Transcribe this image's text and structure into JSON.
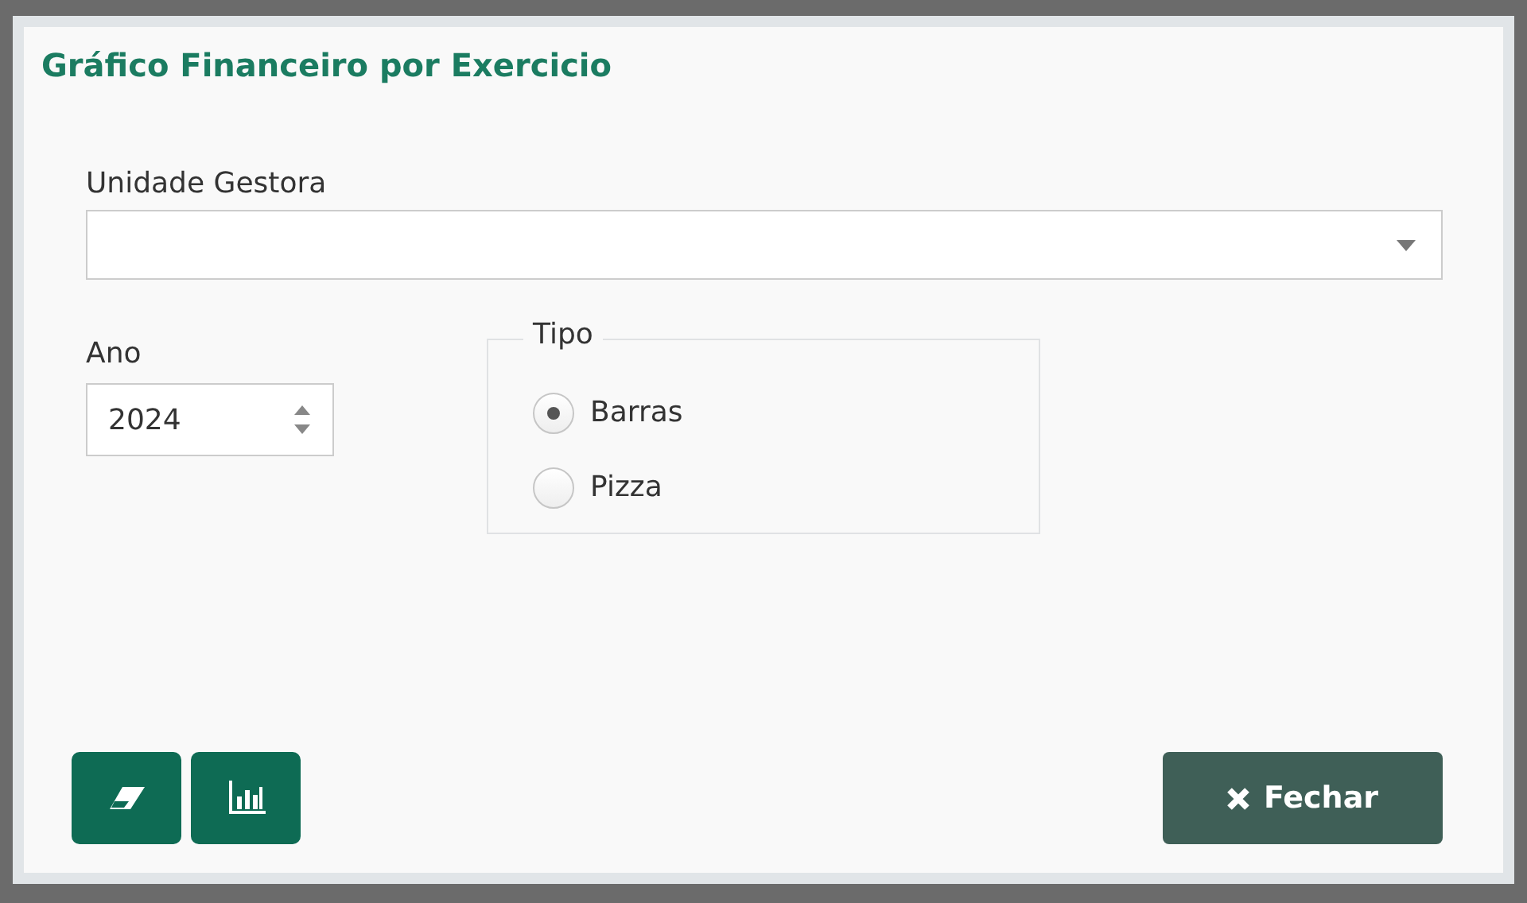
{
  "dialog": {
    "title": "Gráfico Financeiro por Exercicio"
  },
  "unidade_gestora": {
    "label": "Unidade Gestora"
  },
  "ano": {
    "label": "Ano",
    "value": "2024"
  },
  "tipo": {
    "legend": "Tipo",
    "options": [
      {
        "label": "Barras",
        "selected": true
      },
      {
        "label": "Pizza",
        "selected": false
      }
    ]
  },
  "buttons": [
    {
      "kind": "eraser"
    },
    {
      "kind": "chart"
    },
    {
      "kind": "close",
      "label": "Fechar"
    }
  ]
}
